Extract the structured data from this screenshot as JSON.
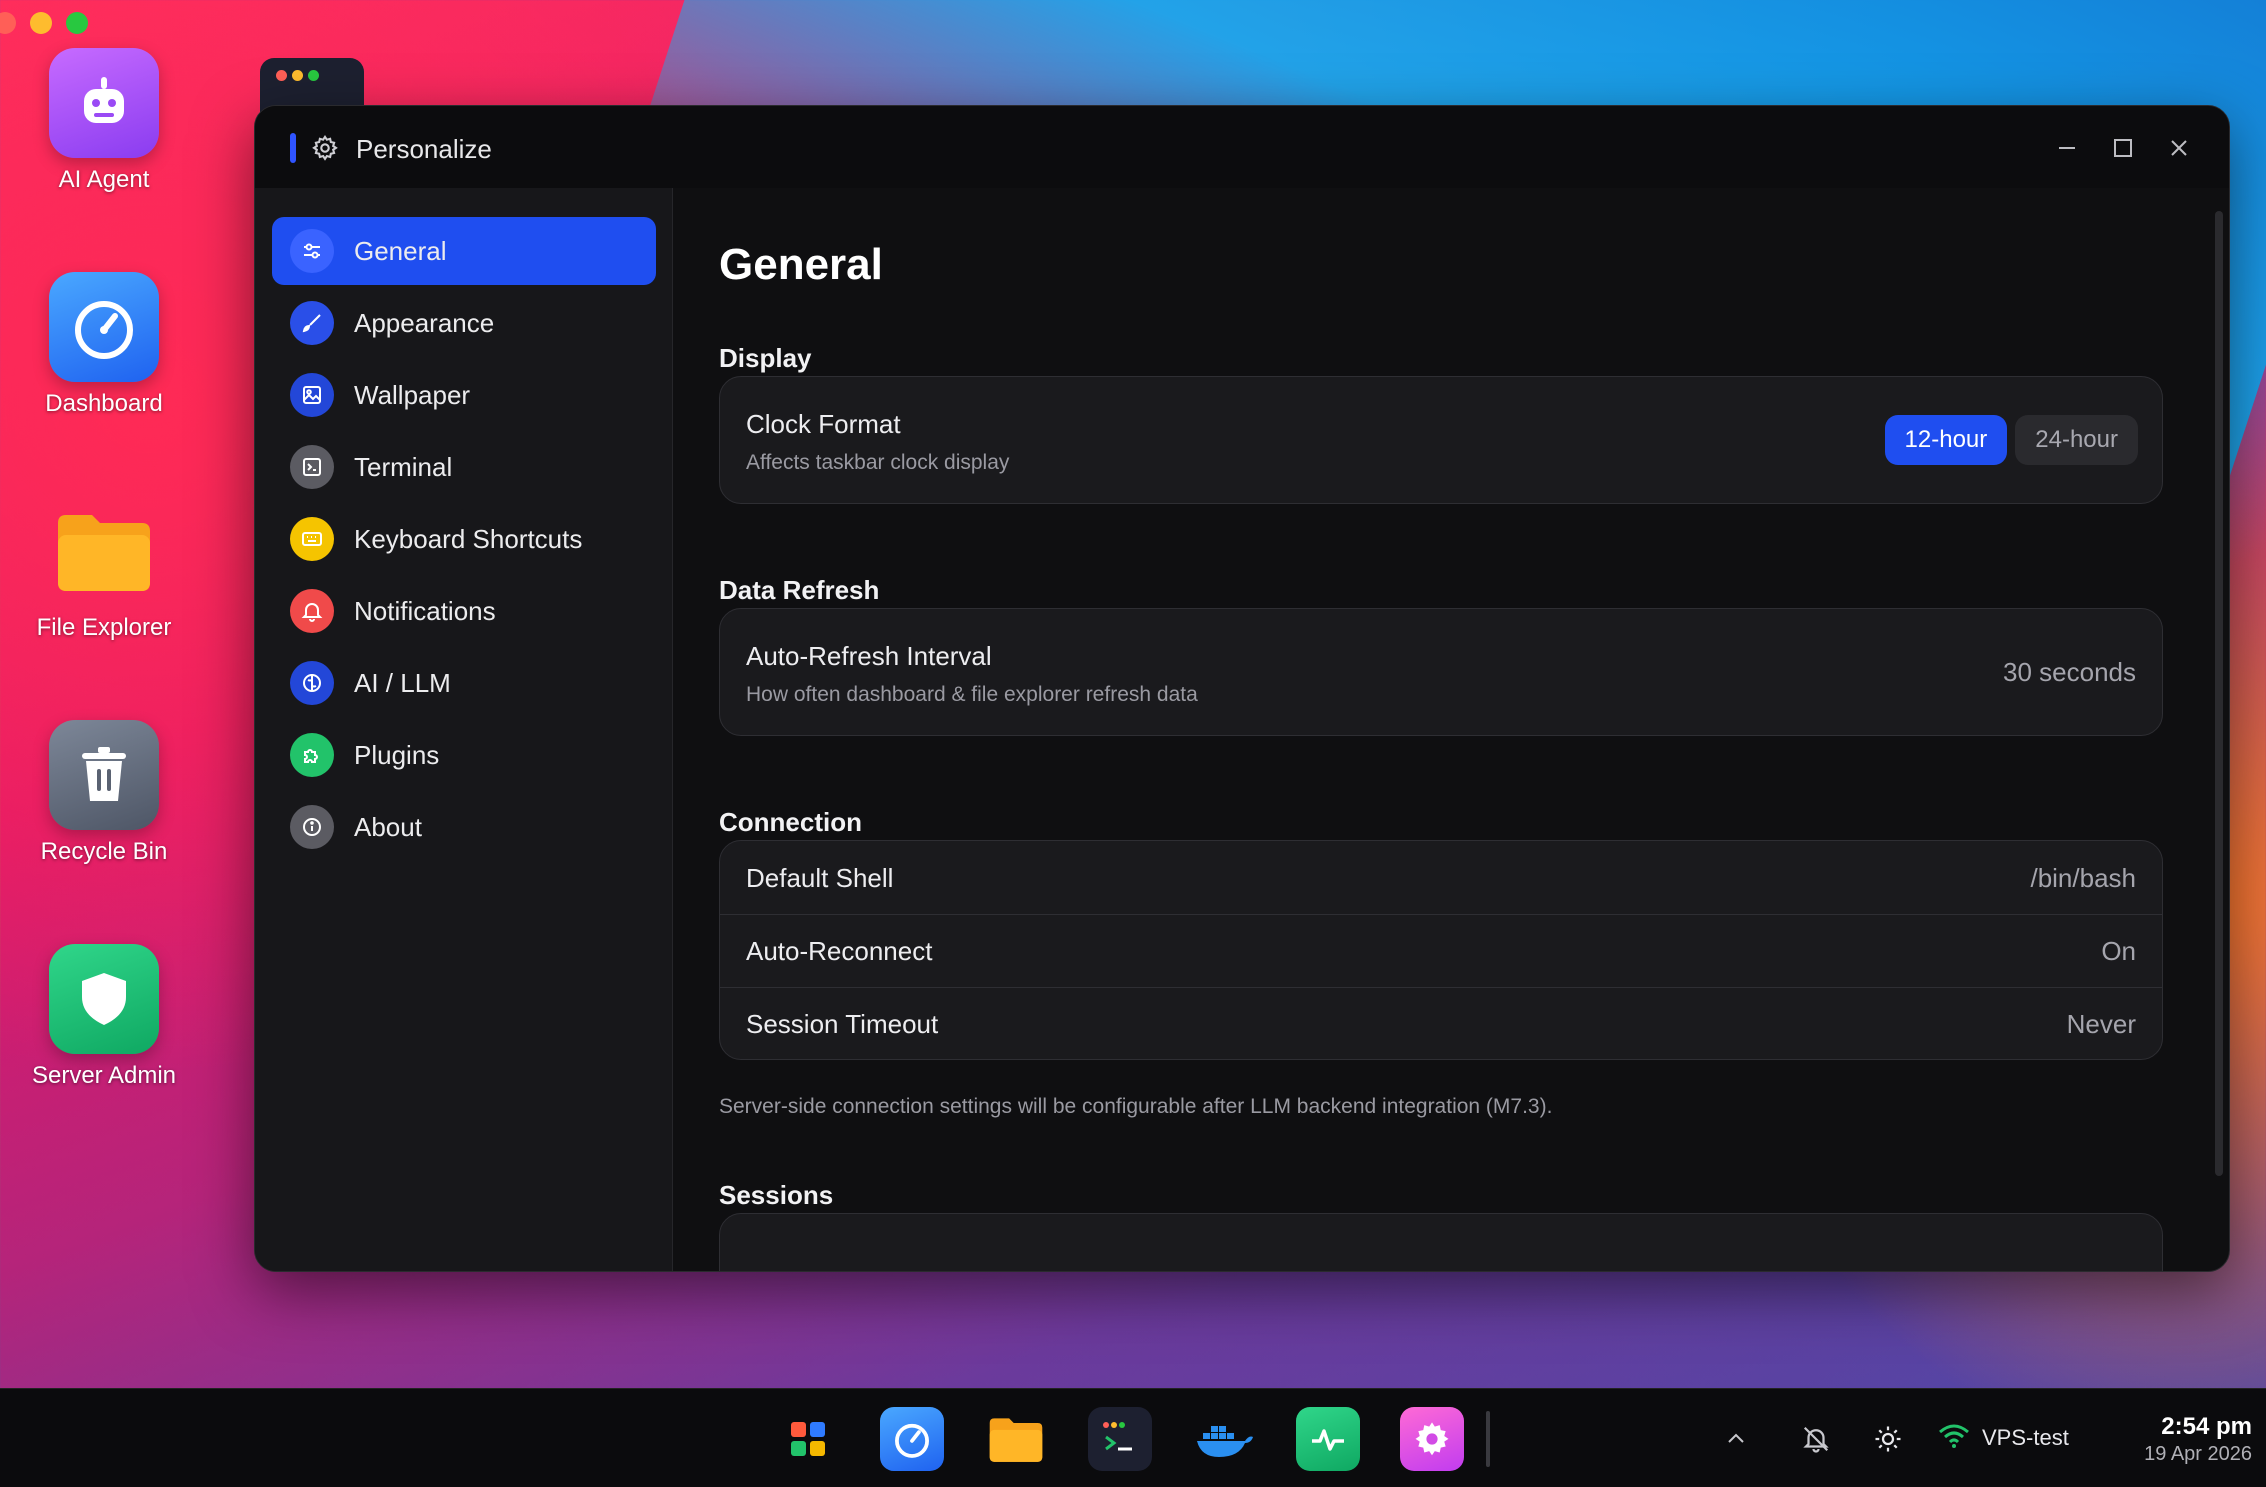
{
  "desktop": {
    "icons": [
      {
        "label": "AI Agent"
      },
      {
        "label": "Dashboard"
      },
      {
        "label": "File Explorer"
      },
      {
        "label": "Recycle Bin"
      },
      {
        "label": "Server Admin"
      }
    ]
  },
  "window": {
    "title": "Personalize",
    "controls": [
      "minimize-icon",
      "maximize-icon",
      "close-icon"
    ]
  },
  "sidebar": {
    "items": [
      {
        "label": "General",
        "icon": "sliders-icon",
        "color": "#3a63ff",
        "active": true
      },
      {
        "label": "Appearance",
        "icon": "brush-icon",
        "color": "#2a4fe8"
      },
      {
        "label": "Wallpaper",
        "icon": "image-icon",
        "color": "#2347d8"
      },
      {
        "label": "Terminal",
        "icon": "terminal-icon",
        "color": "#5b5b62"
      },
      {
        "label": "Keyboard Shortcuts",
        "icon": "keyboard-icon",
        "color": "#f5c400"
      },
      {
        "label": "Notifications",
        "icon": "bell-icon",
        "color": "#f04a4a"
      },
      {
        "label": "AI / LLM",
        "icon": "brain-icon",
        "color": "#2347d8"
      },
      {
        "label": "Plugins",
        "icon": "puzzle-icon",
        "color": "#22c36a"
      },
      {
        "label": "About",
        "icon": "info-icon",
        "color": "#5b5b62"
      }
    ]
  },
  "main": {
    "title": "General",
    "display": {
      "heading": "Display",
      "clock_title": "Clock Format",
      "clock_sub": "Affects taskbar clock display",
      "opt_12": "12-hour",
      "opt_24": "24-hour",
      "selected": "12-hour"
    },
    "refresh": {
      "heading": "Data Refresh",
      "title": "Auto-Refresh Interval",
      "sub": "How often dashboard & file explorer refresh data",
      "value": "30 seconds"
    },
    "connection": {
      "heading": "Connection",
      "rows": [
        {
          "label": "Default Shell",
          "value": "/bin/bash"
        },
        {
          "label": "Auto-Reconnect",
          "value": "On"
        },
        {
          "label": "Session Timeout",
          "value": "Never"
        }
      ],
      "note": "Server-side connection settings will be configurable after LLM backend integration (M7.3)."
    },
    "sessions": {
      "heading": "Sessions"
    }
  },
  "taskbar": {
    "apps": [
      "start-icon",
      "dashboard-icon",
      "folder-icon",
      "terminal-icon",
      "docker-icon",
      "activity-icon",
      "settings-icon"
    ],
    "network": "VPS-test",
    "time": "2:54 pm",
    "date": "19 Apr 2026"
  }
}
